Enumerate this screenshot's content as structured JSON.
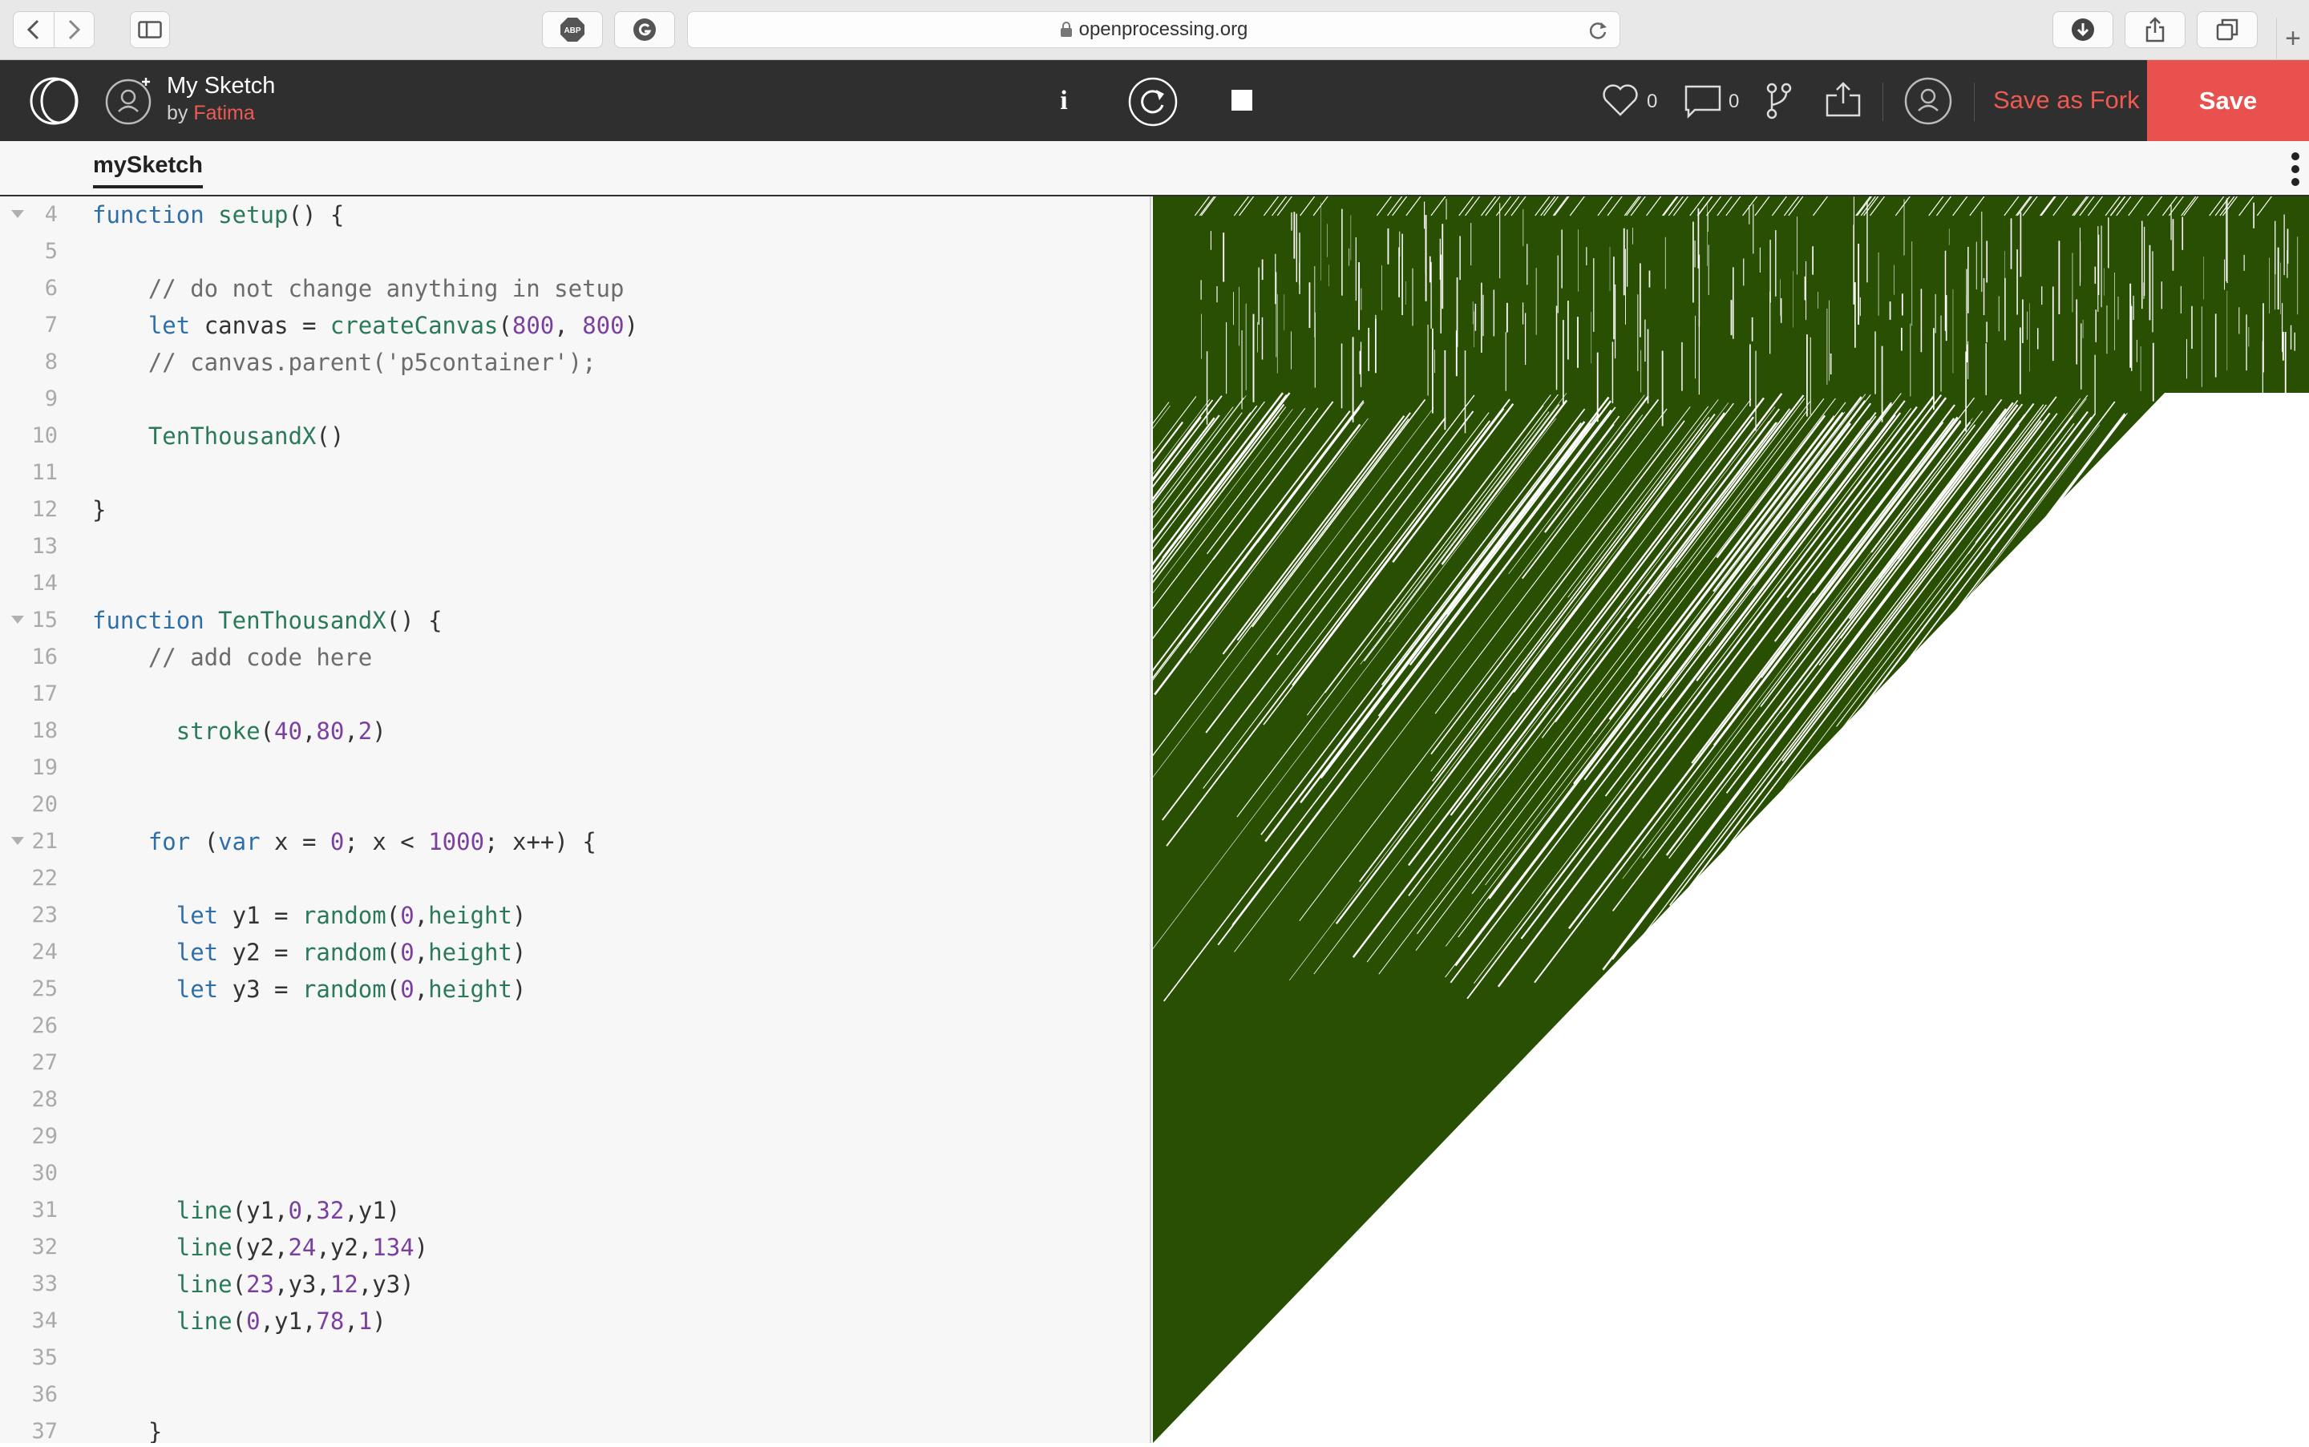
{
  "browser": {
    "url": "openprocessing.org",
    "new_tab": "+"
  },
  "app": {
    "sketch_title": "My Sketch",
    "by_prefix": "by",
    "author": "Fatima",
    "info_label": "i",
    "like_count": "0",
    "comment_count": "0",
    "save_as_fork_label": "Save as Fork",
    "save_label": "Save"
  },
  "tabs": [
    {
      "label": "mySketch"
    }
  ],
  "editor": {
    "lines": [
      {
        "n": "4",
        "fold": true,
        "code": "function setup() {"
      },
      {
        "n": "5",
        "fold": false,
        "code": ""
      },
      {
        "n": "6",
        "fold": false,
        "code": "    // do not change anything in setup"
      },
      {
        "n": "7",
        "fold": false,
        "code": "    let canvas = createCanvas(800, 800)"
      },
      {
        "n": "8",
        "fold": false,
        "code": "    // canvas.parent('p5container');"
      },
      {
        "n": "9",
        "fold": false,
        "code": ""
      },
      {
        "n": "10",
        "fold": false,
        "code": "    TenThousandX()"
      },
      {
        "n": "11",
        "fold": false,
        "code": ""
      },
      {
        "n": "12",
        "fold": false,
        "code": "}"
      },
      {
        "n": "13",
        "fold": false,
        "code": ""
      },
      {
        "n": "14",
        "fold": false,
        "code": ""
      },
      {
        "n": "15",
        "fold": true,
        "code": "function TenThousandX() {"
      },
      {
        "n": "16",
        "fold": false,
        "code": "    // add code here"
      },
      {
        "n": "17",
        "fold": false,
        "code": ""
      },
      {
        "n": "18",
        "fold": false,
        "code": "      stroke(40,80,2)"
      },
      {
        "n": "19",
        "fold": false,
        "code": ""
      },
      {
        "n": "20",
        "fold": false,
        "code": ""
      },
      {
        "n": "21",
        "fold": true,
        "code": "    for (var x = 0; x < 1000; x++) {"
      },
      {
        "n": "22",
        "fold": false,
        "code": ""
      },
      {
        "n": "23",
        "fold": false,
        "code": "      let y1 = random(0,height)"
      },
      {
        "n": "24",
        "fold": false,
        "code": "      let y2 = random(0,height)"
      },
      {
        "n": "25",
        "fold": false,
        "code": "      let y3 = random(0,height)"
      },
      {
        "n": "26",
        "fold": false,
        "code": ""
      },
      {
        "n": "27",
        "fold": false,
        "code": ""
      },
      {
        "n": "28",
        "fold": false,
        "code": ""
      },
      {
        "n": "29",
        "fold": false,
        "code": ""
      },
      {
        "n": "30",
        "fold": false,
        "code": ""
      },
      {
        "n": "31",
        "fold": false,
        "code": "      line(y1,0,32,y1)"
      },
      {
        "n": "32",
        "fold": false,
        "code": "      line(y2,24,y2,134)"
      },
      {
        "n": "33",
        "fold": false,
        "code": "      line(23,y3,12,y3)"
      },
      {
        "n": "34",
        "fold": false,
        "code": "      line(0,y1,78,1)"
      },
      {
        "n": "35",
        "fold": false,
        "code": ""
      },
      {
        "n": "36",
        "fold": false,
        "code": ""
      },
      {
        "n": "37",
        "fold": false,
        "code": "    }"
      }
    ]
  },
  "sketch_output": {
    "stroke_color": "#284f02",
    "background": "#ffffff"
  },
  "colors": {
    "accent": "#e8514d",
    "header_bg": "#2f2f2f"
  }
}
